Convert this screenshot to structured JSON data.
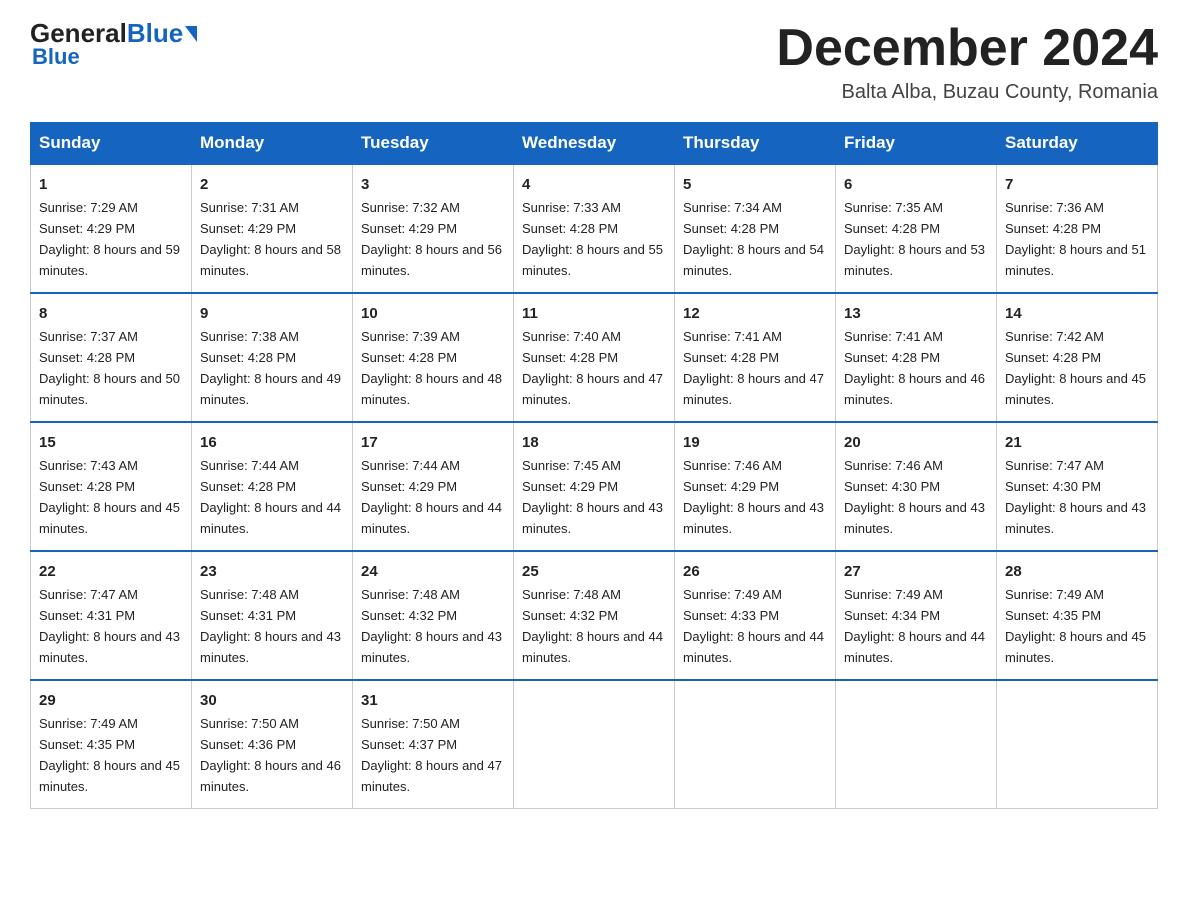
{
  "header": {
    "logo_general": "General",
    "logo_blue": "Blue",
    "month_title": "December 2024",
    "location": "Balta Alba, Buzau County, Romania"
  },
  "days_of_week": [
    "Sunday",
    "Monday",
    "Tuesday",
    "Wednesday",
    "Thursday",
    "Friday",
    "Saturday"
  ],
  "weeks": [
    [
      {
        "day": "1",
        "sunrise": "7:29 AM",
        "sunset": "4:29 PM",
        "daylight": "8 hours and 59 minutes."
      },
      {
        "day": "2",
        "sunrise": "7:31 AM",
        "sunset": "4:29 PM",
        "daylight": "8 hours and 58 minutes."
      },
      {
        "day": "3",
        "sunrise": "7:32 AM",
        "sunset": "4:29 PM",
        "daylight": "8 hours and 56 minutes."
      },
      {
        "day": "4",
        "sunrise": "7:33 AM",
        "sunset": "4:28 PM",
        "daylight": "8 hours and 55 minutes."
      },
      {
        "day": "5",
        "sunrise": "7:34 AM",
        "sunset": "4:28 PM",
        "daylight": "8 hours and 54 minutes."
      },
      {
        "day": "6",
        "sunrise": "7:35 AM",
        "sunset": "4:28 PM",
        "daylight": "8 hours and 53 minutes."
      },
      {
        "day": "7",
        "sunrise": "7:36 AM",
        "sunset": "4:28 PM",
        "daylight": "8 hours and 51 minutes."
      }
    ],
    [
      {
        "day": "8",
        "sunrise": "7:37 AM",
        "sunset": "4:28 PM",
        "daylight": "8 hours and 50 minutes."
      },
      {
        "day": "9",
        "sunrise": "7:38 AM",
        "sunset": "4:28 PM",
        "daylight": "8 hours and 49 minutes."
      },
      {
        "day": "10",
        "sunrise": "7:39 AM",
        "sunset": "4:28 PM",
        "daylight": "8 hours and 48 minutes."
      },
      {
        "day": "11",
        "sunrise": "7:40 AM",
        "sunset": "4:28 PM",
        "daylight": "8 hours and 47 minutes."
      },
      {
        "day": "12",
        "sunrise": "7:41 AM",
        "sunset": "4:28 PM",
        "daylight": "8 hours and 47 minutes."
      },
      {
        "day": "13",
        "sunrise": "7:41 AM",
        "sunset": "4:28 PM",
        "daylight": "8 hours and 46 minutes."
      },
      {
        "day": "14",
        "sunrise": "7:42 AM",
        "sunset": "4:28 PM",
        "daylight": "8 hours and 45 minutes."
      }
    ],
    [
      {
        "day": "15",
        "sunrise": "7:43 AM",
        "sunset": "4:28 PM",
        "daylight": "8 hours and 45 minutes."
      },
      {
        "day": "16",
        "sunrise": "7:44 AM",
        "sunset": "4:28 PM",
        "daylight": "8 hours and 44 minutes."
      },
      {
        "day": "17",
        "sunrise": "7:44 AM",
        "sunset": "4:29 PM",
        "daylight": "8 hours and 44 minutes."
      },
      {
        "day": "18",
        "sunrise": "7:45 AM",
        "sunset": "4:29 PM",
        "daylight": "8 hours and 43 minutes."
      },
      {
        "day": "19",
        "sunrise": "7:46 AM",
        "sunset": "4:29 PM",
        "daylight": "8 hours and 43 minutes."
      },
      {
        "day": "20",
        "sunrise": "7:46 AM",
        "sunset": "4:30 PM",
        "daylight": "8 hours and 43 minutes."
      },
      {
        "day": "21",
        "sunrise": "7:47 AM",
        "sunset": "4:30 PM",
        "daylight": "8 hours and 43 minutes."
      }
    ],
    [
      {
        "day": "22",
        "sunrise": "7:47 AM",
        "sunset": "4:31 PM",
        "daylight": "8 hours and 43 minutes."
      },
      {
        "day": "23",
        "sunrise": "7:48 AM",
        "sunset": "4:31 PM",
        "daylight": "8 hours and 43 minutes."
      },
      {
        "day": "24",
        "sunrise": "7:48 AM",
        "sunset": "4:32 PM",
        "daylight": "8 hours and 43 minutes."
      },
      {
        "day": "25",
        "sunrise": "7:48 AM",
        "sunset": "4:32 PM",
        "daylight": "8 hours and 44 minutes."
      },
      {
        "day": "26",
        "sunrise": "7:49 AM",
        "sunset": "4:33 PM",
        "daylight": "8 hours and 44 minutes."
      },
      {
        "day": "27",
        "sunrise": "7:49 AM",
        "sunset": "4:34 PM",
        "daylight": "8 hours and 44 minutes."
      },
      {
        "day": "28",
        "sunrise": "7:49 AM",
        "sunset": "4:35 PM",
        "daylight": "8 hours and 45 minutes."
      }
    ],
    [
      {
        "day": "29",
        "sunrise": "7:49 AM",
        "sunset": "4:35 PM",
        "daylight": "8 hours and 45 minutes."
      },
      {
        "day": "30",
        "sunrise": "7:50 AM",
        "sunset": "4:36 PM",
        "daylight": "8 hours and 46 minutes."
      },
      {
        "day": "31",
        "sunrise": "7:50 AM",
        "sunset": "4:37 PM",
        "daylight": "8 hours and 47 minutes."
      },
      null,
      null,
      null,
      null
    ]
  ]
}
